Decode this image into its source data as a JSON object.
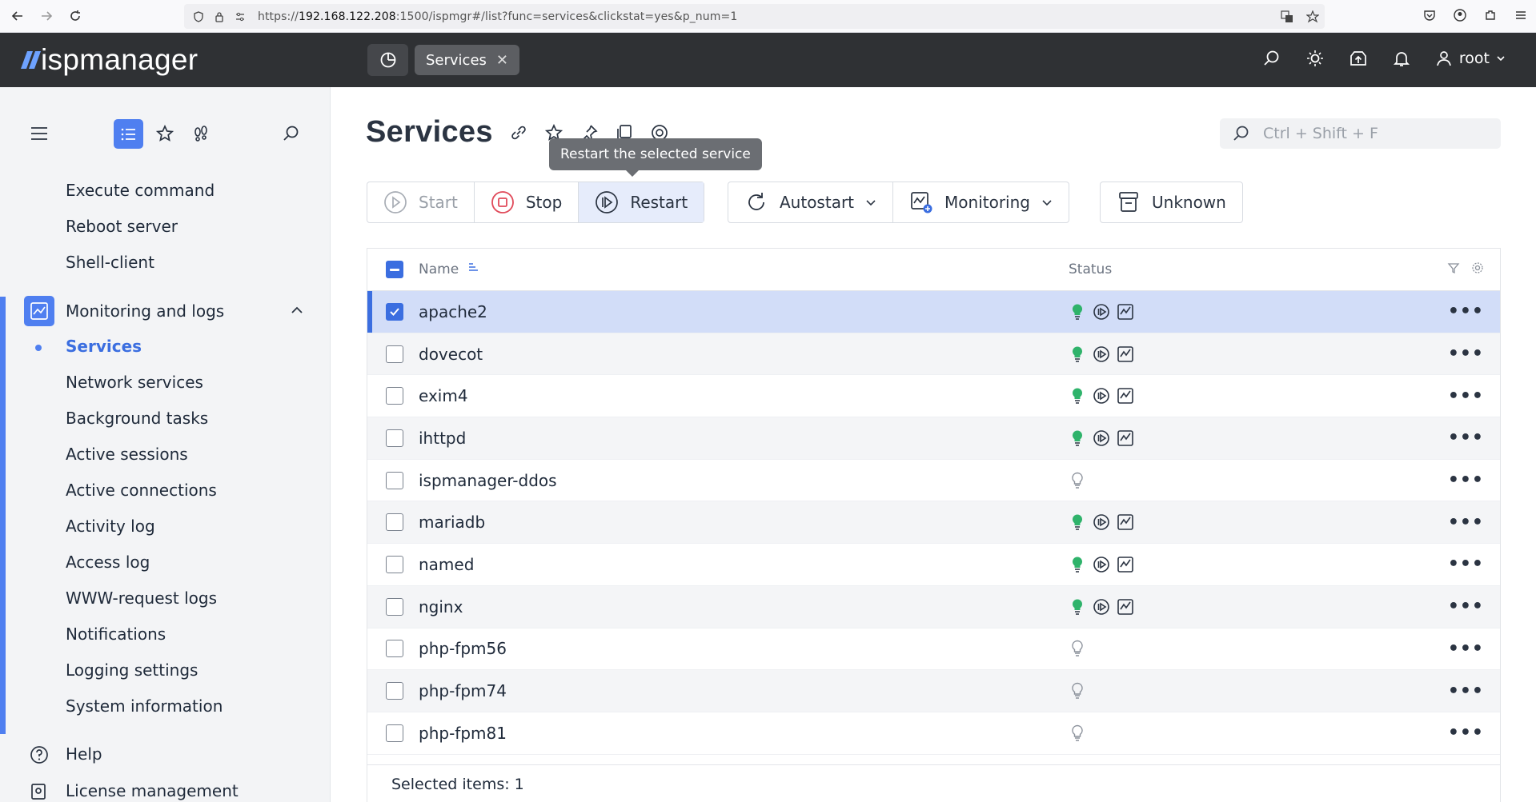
{
  "browser": {
    "url_prefix": "https://",
    "url_host": "192.168.122.208",
    "url_rest": ":1500/ispmgr#/list?func=services&clickstat=yes&p_num=1"
  },
  "header": {
    "logo_text": "ispmanager",
    "open_tab": "Services",
    "user": "root"
  },
  "sidebar": {
    "items_top": [
      "Execute command",
      "Reboot server",
      "Shell-client"
    ],
    "group_label": "Monitoring and logs",
    "group_items": [
      "Services",
      "Network services",
      "Background tasks",
      "Active sessions",
      "Active connections",
      "Activity log",
      "Access log",
      "WWW-request logs",
      "Notifications",
      "Logging settings",
      "System information"
    ],
    "bottom_items": [
      "Help",
      "License management"
    ]
  },
  "main": {
    "title": "Services",
    "tooltip": "Restart the selected service",
    "search_placeholder": "Ctrl + Shift + F",
    "toolbar": {
      "start": "Start",
      "stop": "Stop",
      "restart": "Restart",
      "autostart": "Autostart",
      "monitoring": "Monitoring",
      "unknown": "Unknown"
    },
    "table": {
      "col_name": "Name",
      "col_status": "Status",
      "rows": [
        {
          "name": "apache2",
          "active": true,
          "selected": true
        },
        {
          "name": "dovecot",
          "active": true,
          "selected": false
        },
        {
          "name": "exim4",
          "active": true,
          "selected": false
        },
        {
          "name": "ihttpd",
          "active": true,
          "selected": false
        },
        {
          "name": "ispmanager-ddos",
          "active": false,
          "selected": false
        },
        {
          "name": "mariadb",
          "active": true,
          "selected": false
        },
        {
          "name": "named",
          "active": true,
          "selected": false
        },
        {
          "name": "nginx",
          "active": true,
          "selected": false
        },
        {
          "name": "php-fpm56",
          "active": false,
          "selected": false
        },
        {
          "name": "php-fpm74",
          "active": false,
          "selected": false
        },
        {
          "name": "php-fpm81",
          "active": false,
          "selected": false
        }
      ],
      "footer": "Selected items: 1"
    }
  },
  "colors": {
    "accent": "#4f7ff0",
    "header_bg": "#2f3134",
    "active_status": "#2fb36b"
  }
}
